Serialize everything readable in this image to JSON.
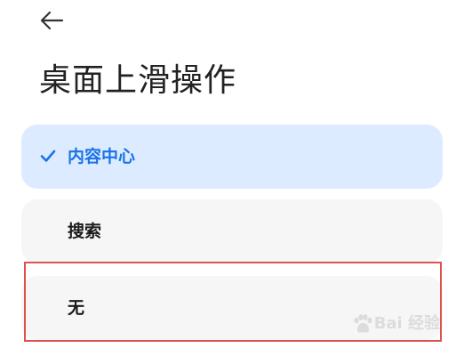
{
  "header": {
    "back_icon": "arrow-left-icon",
    "title": "桌面上滑操作"
  },
  "options": [
    {
      "label": "内容中心",
      "selected": true,
      "icon": "checkmark-icon"
    },
    {
      "label": "搜索",
      "selected": false
    },
    {
      "label": "无",
      "selected": false
    }
  ],
  "watermark": {
    "text": "Bai 经验"
  },
  "colors": {
    "accent": "#1a73e8",
    "selected_bg": "#dcebff",
    "option_bg": "#f6f6f6",
    "highlight_border": "#d9534f"
  }
}
